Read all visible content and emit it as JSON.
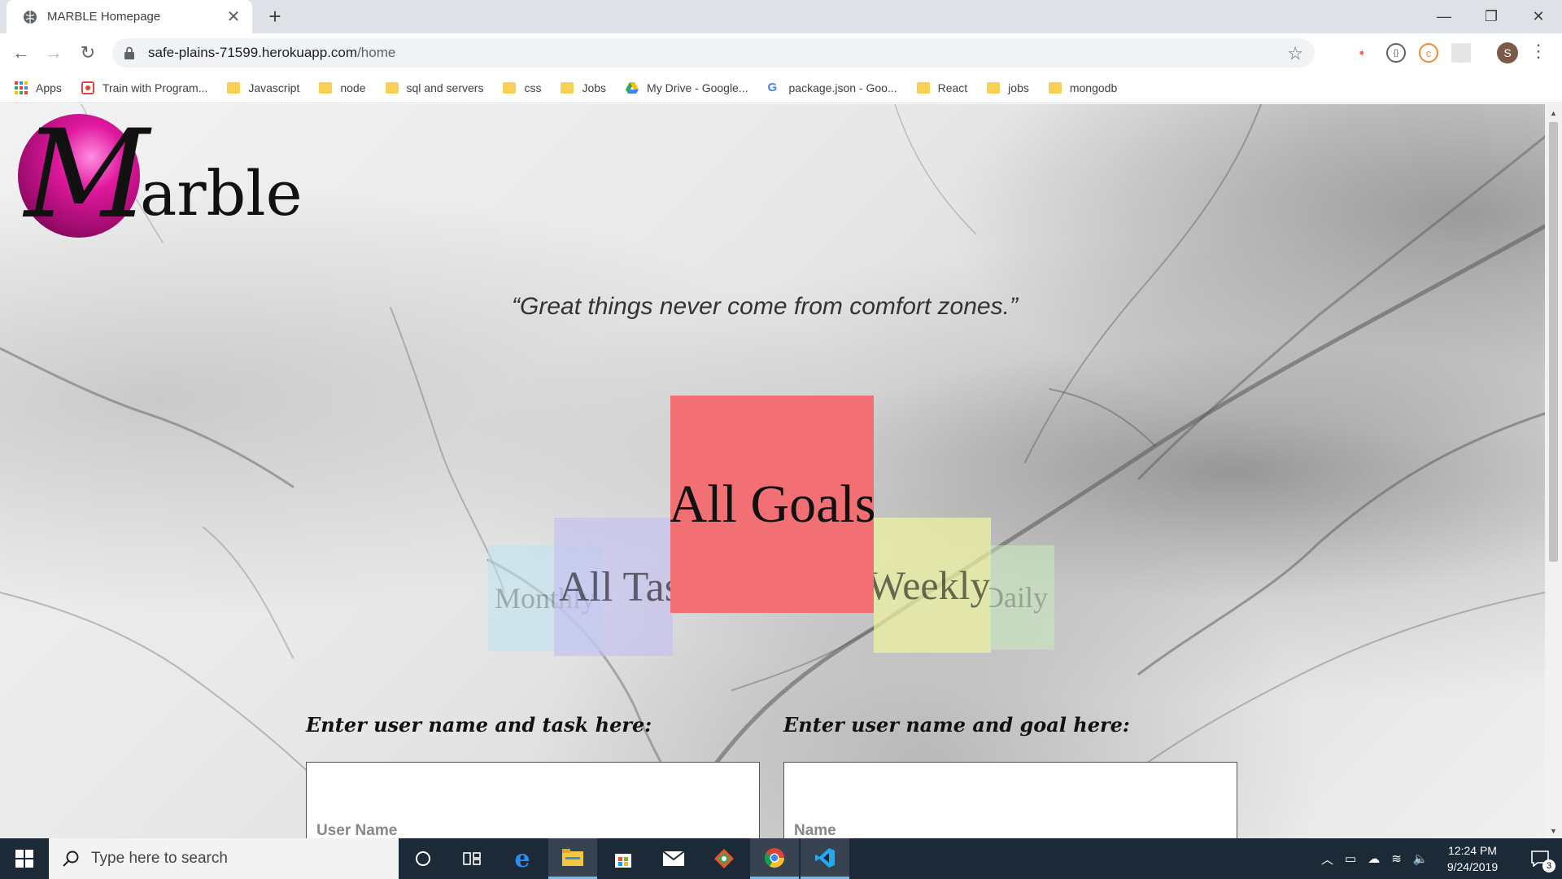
{
  "browser": {
    "tab_title": "MARBLE Homepage",
    "tab_close": "✕",
    "new_tab": "+",
    "window_controls": {
      "minimize": "—",
      "maximize": "❐",
      "close": "✕"
    },
    "url_host": "safe-plains-71599.herokuapp.com",
    "url_path": "/home",
    "profile_initial": "S"
  },
  "bookmarks": [
    {
      "label": "Apps",
      "icon": "apps-grid-icon"
    },
    {
      "label": "Train with Program...",
      "icon": "program-icon"
    },
    {
      "label": "Javascript",
      "icon": "folder-icon"
    },
    {
      "label": "node",
      "icon": "folder-icon"
    },
    {
      "label": "sql and servers",
      "icon": "folder-icon"
    },
    {
      "label": "css",
      "icon": "folder-icon"
    },
    {
      "label": "Jobs",
      "icon": "folder-icon"
    },
    {
      "label": "My Drive - Google...",
      "icon": "google-drive-icon"
    },
    {
      "label": "package.json - Goo...",
      "icon": "google-icon"
    },
    {
      "label": "React",
      "icon": "folder-icon"
    },
    {
      "label": "jobs",
      "icon": "folder-icon"
    },
    {
      "label": "mongodb",
      "icon": "folder-icon"
    }
  ],
  "page": {
    "logo_M": "M",
    "logo_rest": "arble",
    "quote": "“Great things never come from comfort zones.”",
    "carousel": {
      "monthly": "Monthly",
      "tasks": "All Tasks",
      "goals": "All Goals",
      "weekly": "Weekly",
      "daily": "Daily"
    },
    "task_form": {
      "label": "Enter user name and task here:",
      "placeholder": "User Name"
    },
    "goal_form": {
      "label": "Enter user name and goal here:",
      "placeholder": "Name"
    }
  },
  "taskbar": {
    "search_placeholder": "Type here to search",
    "time": "12:24 PM",
    "date": "9/24/2019",
    "notification_count": "3"
  },
  "colors": {
    "goals_card": "#f27073",
    "tasks_card": "#c3bef0",
    "weekly_card": "#f0f5a0",
    "monthly_card": "#bee1f0",
    "daily_card": "#c8ebbe",
    "logo_ball": "#e0189e"
  }
}
